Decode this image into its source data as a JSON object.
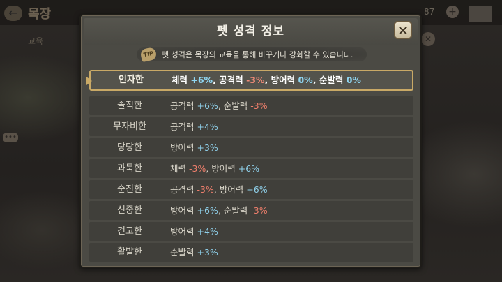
{
  "background": {
    "title": "목장",
    "subtitle": "교육",
    "stat": "87"
  },
  "dialog": {
    "title": "펫 성격 정보",
    "close_icon": "close-icon",
    "tip": {
      "icon_text": "TIP",
      "text": "펫 성격은 목장의 교육을 통해 바꾸거나  강화할 수 있습니다."
    }
  },
  "personalities": [
    {
      "name": "인자한",
      "selected": true,
      "effects": [
        {
          "stat": "체력",
          "value": "+6%",
          "kind": "pos"
        },
        {
          "stat": "공격력",
          "value": "-3%",
          "kind": "neg"
        },
        {
          "stat": "방어력",
          "value": " 0%",
          "kind": "pos"
        },
        {
          "stat": "순발력",
          "value": " 0%",
          "kind": "pos"
        }
      ]
    },
    {
      "name": "솔직한",
      "effects": [
        {
          "stat": "공격력",
          "value": "+6%",
          "kind": "pos"
        },
        {
          "stat": "순발력",
          "value": "-3%",
          "kind": "neg"
        }
      ]
    },
    {
      "name": "무자비한",
      "effects": [
        {
          "stat": "공격력",
          "value": "+4%",
          "kind": "pos"
        }
      ]
    },
    {
      "name": "당당한",
      "effects": [
        {
          "stat": "방어력",
          "value": "+3%",
          "kind": "pos"
        }
      ]
    },
    {
      "name": "과묵한",
      "effects": [
        {
          "stat": "체력",
          "value": "-3%",
          "kind": "neg"
        },
        {
          "stat": "방어력",
          "value": "+6%",
          "kind": "pos"
        }
      ]
    },
    {
      "name": "순진한",
      "effects": [
        {
          "stat": "공격력",
          "value": "-3%",
          "kind": "neg"
        },
        {
          "stat": "방어력",
          "value": "+6%",
          "kind": "pos"
        }
      ]
    },
    {
      "name": "신중한",
      "effects": [
        {
          "stat": "방어력",
          "value": "+6%",
          "kind": "pos"
        },
        {
          "stat": "순발력",
          "value": "-3%",
          "kind": "neg"
        }
      ]
    },
    {
      "name": "견고한",
      "effects": [
        {
          "stat": "방어력",
          "value": "+4%",
          "kind": "pos"
        }
      ]
    },
    {
      "name": "활발한",
      "effects": [
        {
          "stat": "순발력",
          "value": "+3%",
          "kind": "pos"
        }
      ]
    }
  ],
  "colors": {
    "positive": "#8fd0ea",
    "negative": "#ef7f6c",
    "highlight_border": "#c9a966"
  }
}
